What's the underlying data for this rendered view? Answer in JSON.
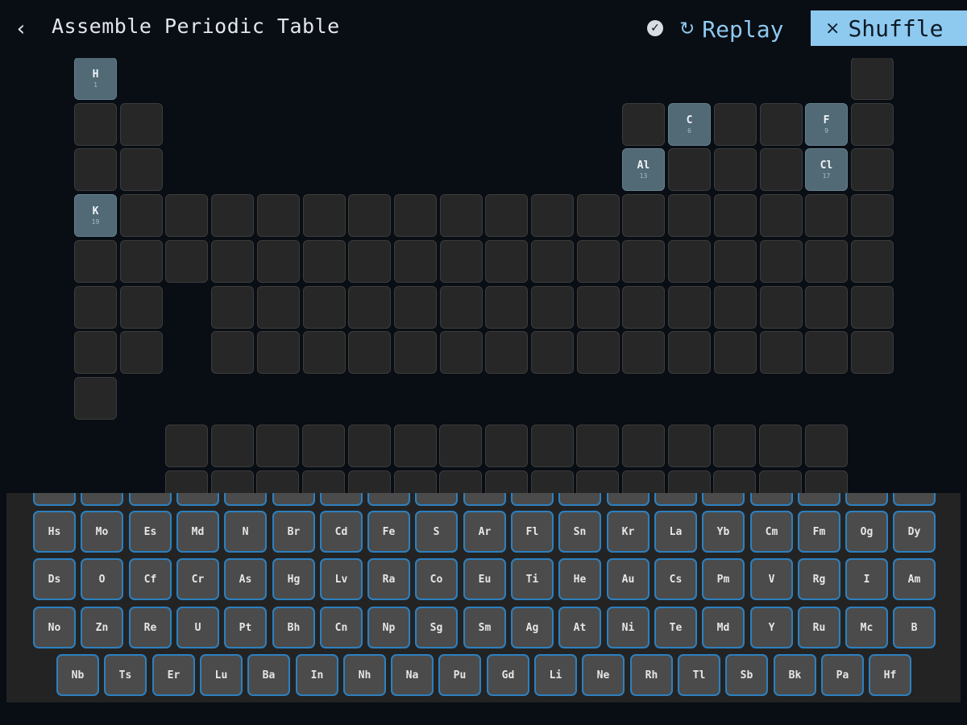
{
  "header": {
    "back_icon": "chevron-left-icon",
    "title": "Assemble Periodic Table",
    "status_icon": "check-circle-icon",
    "replay_icon": "refresh-icon",
    "replay_label": "Replay",
    "shuffle_icon": "shuffle-icon",
    "shuffle_label": "Shuffle"
  },
  "colors": {
    "background": "#090d14",
    "accent": "#8ec9f0",
    "placed_tile": "#526976",
    "empty_slot": "#272727",
    "tray_tile_border": "#2d80bf"
  },
  "placed_elements": [
    {
      "symbol": "H",
      "number": "1"
    },
    {
      "symbol": "C",
      "number": "6"
    },
    {
      "symbol": "F",
      "number": "9"
    },
    {
      "symbol": "Al",
      "number": "13"
    },
    {
      "symbol": "Cl",
      "number": "17"
    },
    {
      "symbol": "K",
      "number": "19"
    }
  ],
  "tray": {
    "rows": [
      [
        "Hs",
        "Mo",
        "Es",
        "Md",
        "N",
        "Br",
        "Cd",
        "Fe",
        "S",
        "Ar",
        "Fl",
        "Sn",
        "Kr",
        "La",
        "Yb",
        "Cm",
        "Fm",
        "Og",
        "Dy"
      ],
      [
        "Ds",
        "O",
        "Cf",
        "Cr",
        "As",
        "Hg",
        "Lv",
        "Ra",
        "Co",
        "Eu",
        "Ti",
        "He",
        "Au",
        "Cs",
        "Pm",
        "V",
        "Rg",
        "I",
        "Am"
      ],
      [
        "No",
        "Zn",
        "Re",
        "U",
        "Pt",
        "Bh",
        "Cn",
        "Np",
        "Sg",
        "Sm",
        "Ag",
        "At",
        "Ni",
        "Te",
        "Md",
        "Y",
        "Ru",
        "Mc",
        "B"
      ],
      [
        "Nb",
        "Ts",
        "Er",
        "Lu",
        "Ba",
        "In",
        "Nh",
        "Na",
        "Pu",
        "Gd",
        "Li",
        "Ne",
        "Rh",
        "Tl",
        "Sb",
        "Bk",
        "Pa",
        "Hf"
      ]
    ]
  }
}
